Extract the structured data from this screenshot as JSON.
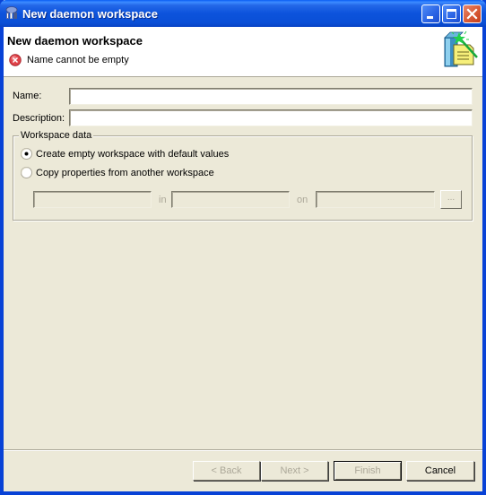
{
  "window": {
    "title": "New daemon workspace",
    "title_icon": "daemon-workspace-icon",
    "controls": [
      "minimize",
      "maximize",
      "close"
    ]
  },
  "header": {
    "title": "New daemon workspace",
    "message": "Name cannot be empty",
    "message_icon": "error-icon",
    "wizard_icon": "new-workspace-wizard-icon"
  },
  "form": {
    "name_label": "Name:",
    "name_value": "",
    "description_label": "Description:",
    "description_value": ""
  },
  "workspace_data": {
    "legend": "Workspace data",
    "options": [
      {
        "label": "Create empty workspace with default values",
        "selected": true
      },
      {
        "label": "Copy properties from another workspace",
        "selected": false
      }
    ],
    "copy_fields": {
      "workspace_value": "",
      "in_label": "in",
      "daemon_value": "",
      "on_label": "on",
      "machine_value": "",
      "browse_label": "..."
    }
  },
  "buttons": {
    "back": {
      "label": "< Back",
      "enabled": false
    },
    "next": {
      "label": "Next >",
      "enabled": false
    },
    "finish": {
      "label": "Finish",
      "enabled": false
    },
    "cancel": {
      "label": "Cancel",
      "enabled": true
    }
  }
}
